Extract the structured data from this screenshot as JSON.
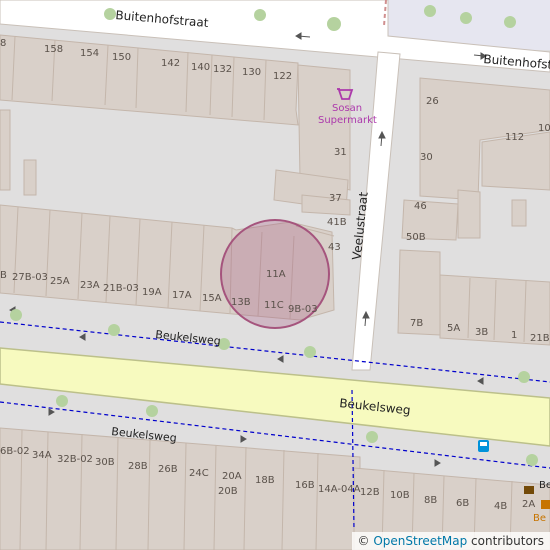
{
  "streets": {
    "buitenhofstraat_left": "Buitenhofstraat",
    "buitenhofstraat_right": "Buitenhofstraat",
    "veelustraat": "Veelustraat",
    "beukelsweg_path": "Beukelsweg",
    "beukelsweg_main": "Beukelsweg",
    "beukelsweg_lower": "Beukelsweg"
  },
  "poi": {
    "supermarket_line1": "Sosan",
    "supermarket_line2": "Supermarkt",
    "supermarket_icon": "basket-icon",
    "bus_icon": "bus-stop-icon",
    "bottom_right_text": "Be",
    "bottom_right_text2": "Be"
  },
  "house_numbers": [
    "8",
    "158",
    "154",
    "150",
    "142",
    "140",
    "132",
    "130",
    "122",
    "31",
    "37",
    "41B",
    "43",
    "B",
    "27B-03",
    "25A",
    "23A",
    "21B-03",
    "19A",
    "17A",
    "15A",
    "13B",
    "11A",
    "11C",
    "9B-03",
    "26",
    "112",
    "10",
    "30",
    "46",
    "50B",
    "7B",
    "5A",
    "3B",
    "1",
    "21B",
    "6B-02",
    "34A",
    "32B-02",
    "30B",
    "28B",
    "26B",
    "24C",
    "20A",
    "20B",
    "18B",
    "16B",
    "14A-04A",
    "12B",
    "10B",
    "8B",
    "6B",
    "4B",
    "2A"
  ],
  "attribution": {
    "symbol": "©",
    "link": "OpenStreetMap",
    "suffix": " contributors"
  },
  "colors": {
    "background": "#e0dfdf",
    "building": "#d9d0c9",
    "building_stroke": "#c4b6ab",
    "road": "#ffffff",
    "main_road": "#f7fabf",
    "main_road_casing": "#bcc08a",
    "footway": "#0000ff",
    "tree": "#b5d29f",
    "highlight": "#a5547d",
    "poi": "#ac39ac",
    "bus": "#0092da"
  }
}
